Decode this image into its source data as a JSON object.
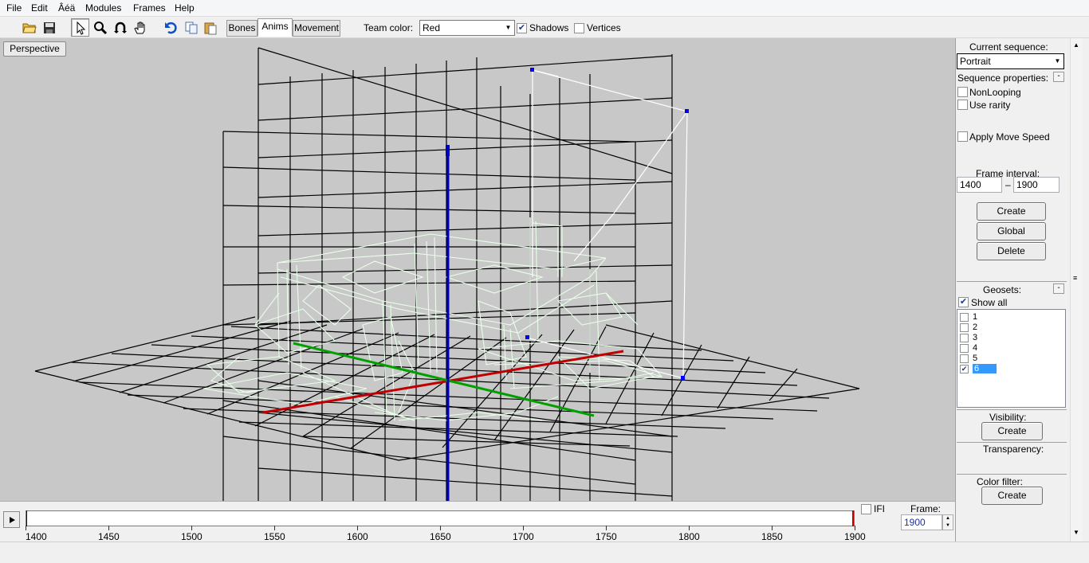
{
  "menu": [
    "File",
    "Edit",
    "Âéä",
    "Modules",
    "Frames",
    "Help"
  ],
  "toolbar": {
    "tabs": [
      "Bones",
      "Anims",
      "Movement"
    ],
    "team_color_label": "Team color:",
    "team_color_value": "Red",
    "shadows_label": "Shadows",
    "shadows_checked": true,
    "vertices_label": "Vertices",
    "vertices_checked": false
  },
  "viewport": {
    "mode_button": "Perspective",
    "background": "#c8c8c8"
  },
  "panel": {
    "current_sequence_label": "Current sequence:",
    "current_sequence_value": "Portrait",
    "sequence_properties_label": "Sequence properties:",
    "nonlooping_label": "NonLooping",
    "use_rarity_label": "Use rarity",
    "apply_move_speed_label": "Apply Move Speed",
    "frame_interval_label": "Frame interval:",
    "frame_start": "1400",
    "frame_dash": "–",
    "frame_end": "1900",
    "create_label": "Create",
    "global_label": "Global",
    "delete_label": "Delete",
    "geosets_label": "Geosets:",
    "show_all_label": "Show all",
    "geosets": [
      {
        "name": "1",
        "checked": false
      },
      {
        "name": "2",
        "checked": false
      },
      {
        "name": "3",
        "checked": false
      },
      {
        "name": "4",
        "checked": false
      },
      {
        "name": "5",
        "checked": false
      },
      {
        "name": "6",
        "checked": true
      }
    ],
    "visibility_label": "Visibility:",
    "visibility_create": "Create",
    "transparency_label": "Transparency:",
    "color_filter_label": "Color filter:",
    "color_filter_create": "Create"
  },
  "timeline": {
    "ifi_label": "IFI",
    "frame_label": "Frame:",
    "frame_value": "1900",
    "ticks": [
      "1400",
      "1450",
      "1500",
      "1550",
      "1600",
      "1650",
      "1700",
      "1750",
      "1800",
      "1850",
      "1900"
    ],
    "cursor_color": "#c00000"
  },
  "colors": {
    "axis_red": "#c00000",
    "axis_green": "#00a000",
    "axis_blue": "#0000c0",
    "wireframe": "#e8ffe8",
    "selection_box": "#ffffff"
  }
}
